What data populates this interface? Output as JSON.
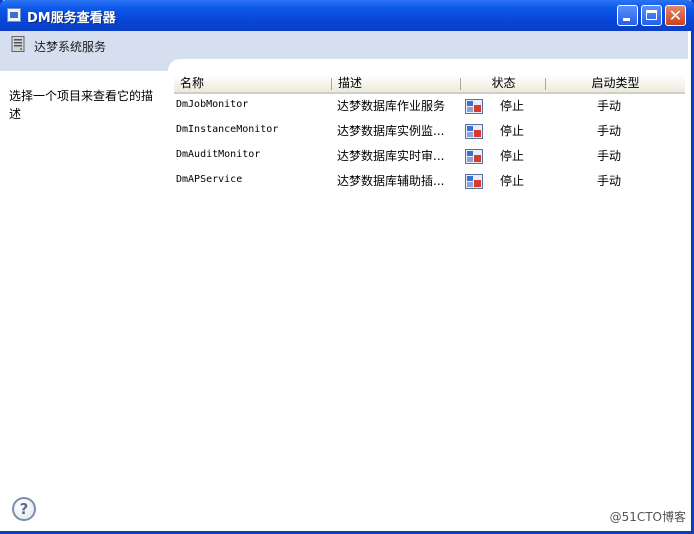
{
  "window": {
    "title": "DM服务查看器"
  },
  "header": {
    "title": "达梦系统服务",
    "icon": "server-icon"
  },
  "left_panel": {
    "description": "选择一个项目来查看它的描述"
  },
  "table": {
    "columns": {
      "name": "名称",
      "description": "描述",
      "status": "状态",
      "startup_type": "启动类型"
    },
    "rows": [
      {
        "name": "DmJobMonitor",
        "description": "达梦数据库作业服务",
        "status": "停止",
        "startup_type": "手动"
      },
      {
        "name": "DmInstanceMonitor",
        "description": "达梦数据库实例监...",
        "status": "停止",
        "startup_type": "手动"
      },
      {
        "name": "DmAuditMonitor",
        "description": "达梦数据库实时审...",
        "status": "停止",
        "startup_type": "手动"
      },
      {
        "name": "DmAPService",
        "description": "达梦数据库辅助插...",
        "status": "停止",
        "startup_type": "手动"
      }
    ]
  },
  "help": {
    "symbol": "?"
  },
  "watermark": "@51CTO博客",
  "colors": {
    "titlebar": "#0a56e8",
    "header_band": "#d6dff0",
    "close_button": "#c9431c"
  }
}
